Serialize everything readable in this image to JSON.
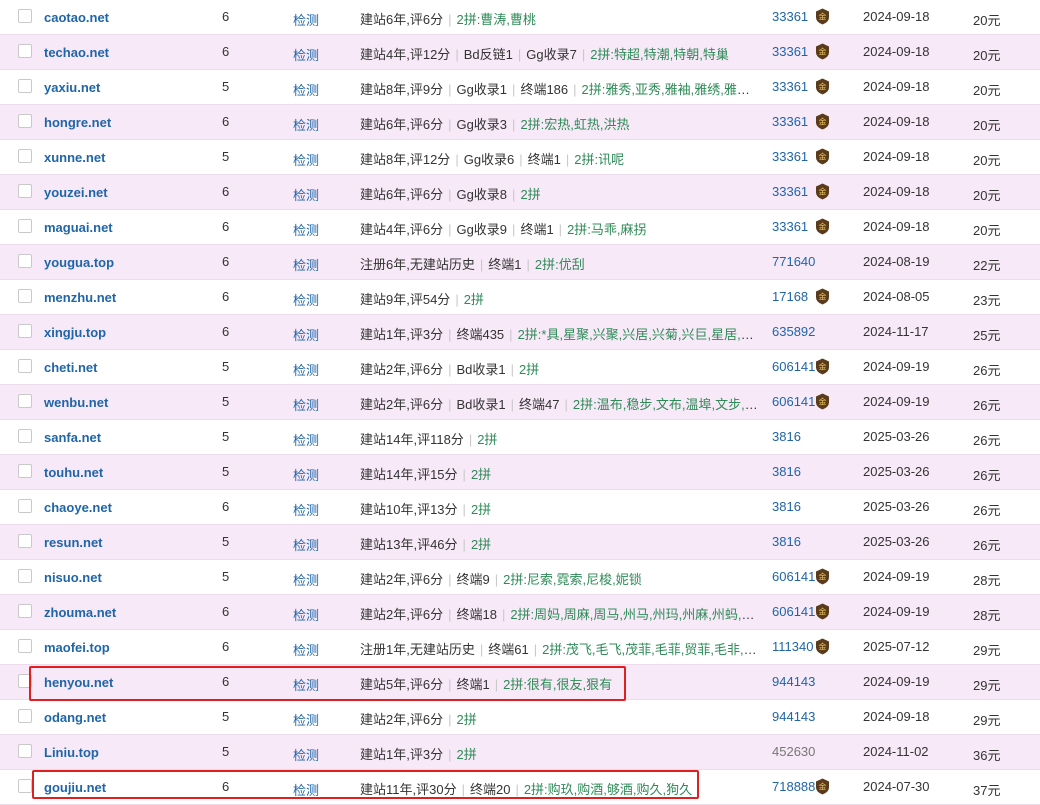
{
  "colors": {
    "link": "#1f65a8",
    "row_alt": "#f7e9f7",
    "highlight": "#e02020",
    "medal": "#5a3b1b"
  },
  "check_label": "检测",
  "separator": "|",
  "rows": [
    {
      "domain": "caotao.net",
      "length": "6",
      "parts": [
        "建站6年,评6分"
      ],
      "pinyin": "2拼:曹涛,曹桃",
      "seller": "33361",
      "medal": true,
      "date": "2024-09-18",
      "price": "20元"
    },
    {
      "domain": "techao.net",
      "length": "6",
      "parts": [
        "建站4年,评12分",
        "Bd反链1",
        "Gg收录7"
      ],
      "pinyin": "2拼:特超,特潮,特朝,特巢",
      "seller": "33361",
      "medal": true,
      "date": "2024-09-18",
      "price": "20元"
    },
    {
      "domain": "yaxiu.net",
      "length": "5",
      "parts": [
        "建站8年,评9分",
        "Gg收录1",
        "终端186"
      ],
      "pinyin": "2拼:雅秀,亚秀,雅袖,雅绣,雅修,...",
      "seller": "33361",
      "medal": true,
      "date": "2024-09-18",
      "price": "20元"
    },
    {
      "domain": "hongre.net",
      "length": "6",
      "parts": [
        "建站6年,评6分",
        "Gg收录3"
      ],
      "pinyin": "2拼:宏热,虹热,洪热",
      "seller": "33361",
      "medal": true,
      "date": "2024-09-18",
      "price": "20元"
    },
    {
      "domain": "xunne.net",
      "length": "5",
      "parts": [
        "建站8年,评12分",
        "Gg收录6",
        "终端1"
      ],
      "pinyin": "2拼:讯呢",
      "seller": "33361",
      "medal": true,
      "date": "2024-09-18",
      "price": "20元"
    },
    {
      "domain": "youzei.net",
      "length": "6",
      "parts": [
        "建站6年,评6分",
        "Gg收录8"
      ],
      "pinyin": "2拼",
      "seller": "33361",
      "medal": true,
      "date": "2024-09-18",
      "price": "20元"
    },
    {
      "domain": "maguai.net",
      "length": "6",
      "parts": [
        "建站4年,评6分",
        "Gg收录9",
        "终端1"
      ],
      "pinyin": "2拼:马乖,麻拐",
      "seller": "33361",
      "medal": true,
      "date": "2024-09-18",
      "price": "20元"
    },
    {
      "domain": "yougua.top",
      "length": "6",
      "parts": [
        "注册6年,无建站历史",
        "终端1"
      ],
      "pinyin": "2拼:优刮",
      "seller": "771640",
      "medal": false,
      "date": "2024-08-19",
      "price": "22元"
    },
    {
      "domain": "menzhu.net",
      "length": "6",
      "parts": [
        "建站9年,评54分"
      ],
      "pinyin": "2拼",
      "seller": "17168",
      "medal": true,
      "date": "2024-08-05",
      "price": "23元"
    },
    {
      "domain": "xingju.top",
      "length": "6",
      "parts": [
        "建站1年,评3分",
        "终端435"
      ],
      "pinyin": "2拼:*具,星聚,兴聚,兴居,兴菊,兴巨,星居,兴...",
      "seller": "635892",
      "medal": false,
      "date": "2024-11-17",
      "price": "25元"
    },
    {
      "domain": "cheti.net",
      "length": "5",
      "parts": [
        "建站2年,评6分",
        "Bd收录1"
      ],
      "pinyin": "2拼",
      "seller": "606141",
      "medal": true,
      "date": "2024-09-19",
      "price": "26元"
    },
    {
      "domain": "wenbu.net",
      "length": "5",
      "parts": [
        "建站2年,评6分",
        "Bd收录1",
        "终端47"
      ],
      "pinyin": "2拼:温布,稳步,文布,温埠,文步,文...",
      "seller": "606141",
      "medal": true,
      "date": "2024-09-19",
      "price": "26元"
    },
    {
      "domain": "sanfa.net",
      "length": "5",
      "parts": [
        "建站14年,评118分"
      ],
      "pinyin": "2拼",
      "seller": "3816",
      "medal": false,
      "date": "2025-03-26",
      "price": "26元"
    },
    {
      "domain": "touhu.net",
      "length": "5",
      "parts": [
        "建站14年,评15分"
      ],
      "pinyin": "2拼",
      "seller": "3816",
      "medal": false,
      "date": "2025-03-26",
      "price": "26元"
    },
    {
      "domain": "chaoye.net",
      "length": "6",
      "parts": [
        "建站10年,评13分"
      ],
      "pinyin": "2拼",
      "seller": "3816",
      "medal": false,
      "date": "2025-03-26",
      "price": "26元"
    },
    {
      "domain": "resun.net",
      "length": "5",
      "parts": [
        "建站13年,评46分"
      ],
      "pinyin": "2拼",
      "seller": "3816",
      "medal": false,
      "date": "2025-03-26",
      "price": "26元"
    },
    {
      "domain": "nisuo.net",
      "length": "5",
      "parts": [
        "建站2年,评6分",
        "终端9"
      ],
      "pinyin": "2拼:尼索,霓索,尼梭,妮锁",
      "seller": "606141",
      "medal": true,
      "date": "2024-09-19",
      "price": "28元"
    },
    {
      "domain": "zhouma.net",
      "length": "6",
      "parts": [
        "建站2年,评6分",
        "终端18"
      ],
      "pinyin": "2拼:周妈,周麻,周马,州马,州玛,州麻,州蚂,洲码",
      "seller": "606141",
      "medal": true,
      "date": "2024-09-19",
      "price": "28元"
    },
    {
      "domain": "maofei.top",
      "length": "6",
      "parts": [
        "注册1年,无建站历史",
        "终端61"
      ],
      "pinyin": "2拼:茂飞,毛飞,茂菲,毛菲,贸菲,毛非,贸...",
      "seller": "111340",
      "medal": true,
      "date": "2025-07-12",
      "price": "29元"
    },
    {
      "domain": "henyou.net",
      "length": "6",
      "parts": [
        "建站5年,评6分",
        "终端1"
      ],
      "pinyin": "2拼:很有,很友,狠有",
      "seller": "944143",
      "medal": false,
      "date": "2024-09-19",
      "price": "29元"
    },
    {
      "domain": "odang.net",
      "length": "5",
      "parts": [
        "建站2年,评6分"
      ],
      "pinyin": "2拼",
      "seller": "944143",
      "medal": false,
      "date": "2024-09-18",
      "price": "29元"
    },
    {
      "domain": "Liniu.top",
      "length": "5",
      "parts": [
        "建站1年,评3分"
      ],
      "pinyin": "2拼",
      "seller": "452630",
      "medal": false,
      "seller_gray": true,
      "date": "2024-11-02",
      "price": "36元"
    },
    {
      "domain": "goujiu.net",
      "length": "6",
      "parts": [
        "建站11年,评30分",
        "终端20"
      ],
      "pinyin": "2拼:购玖,购酒,够酒,购久,狗久",
      "seller": "718888",
      "medal": true,
      "date": "2024-07-30",
      "price": "37元"
    }
  ]
}
